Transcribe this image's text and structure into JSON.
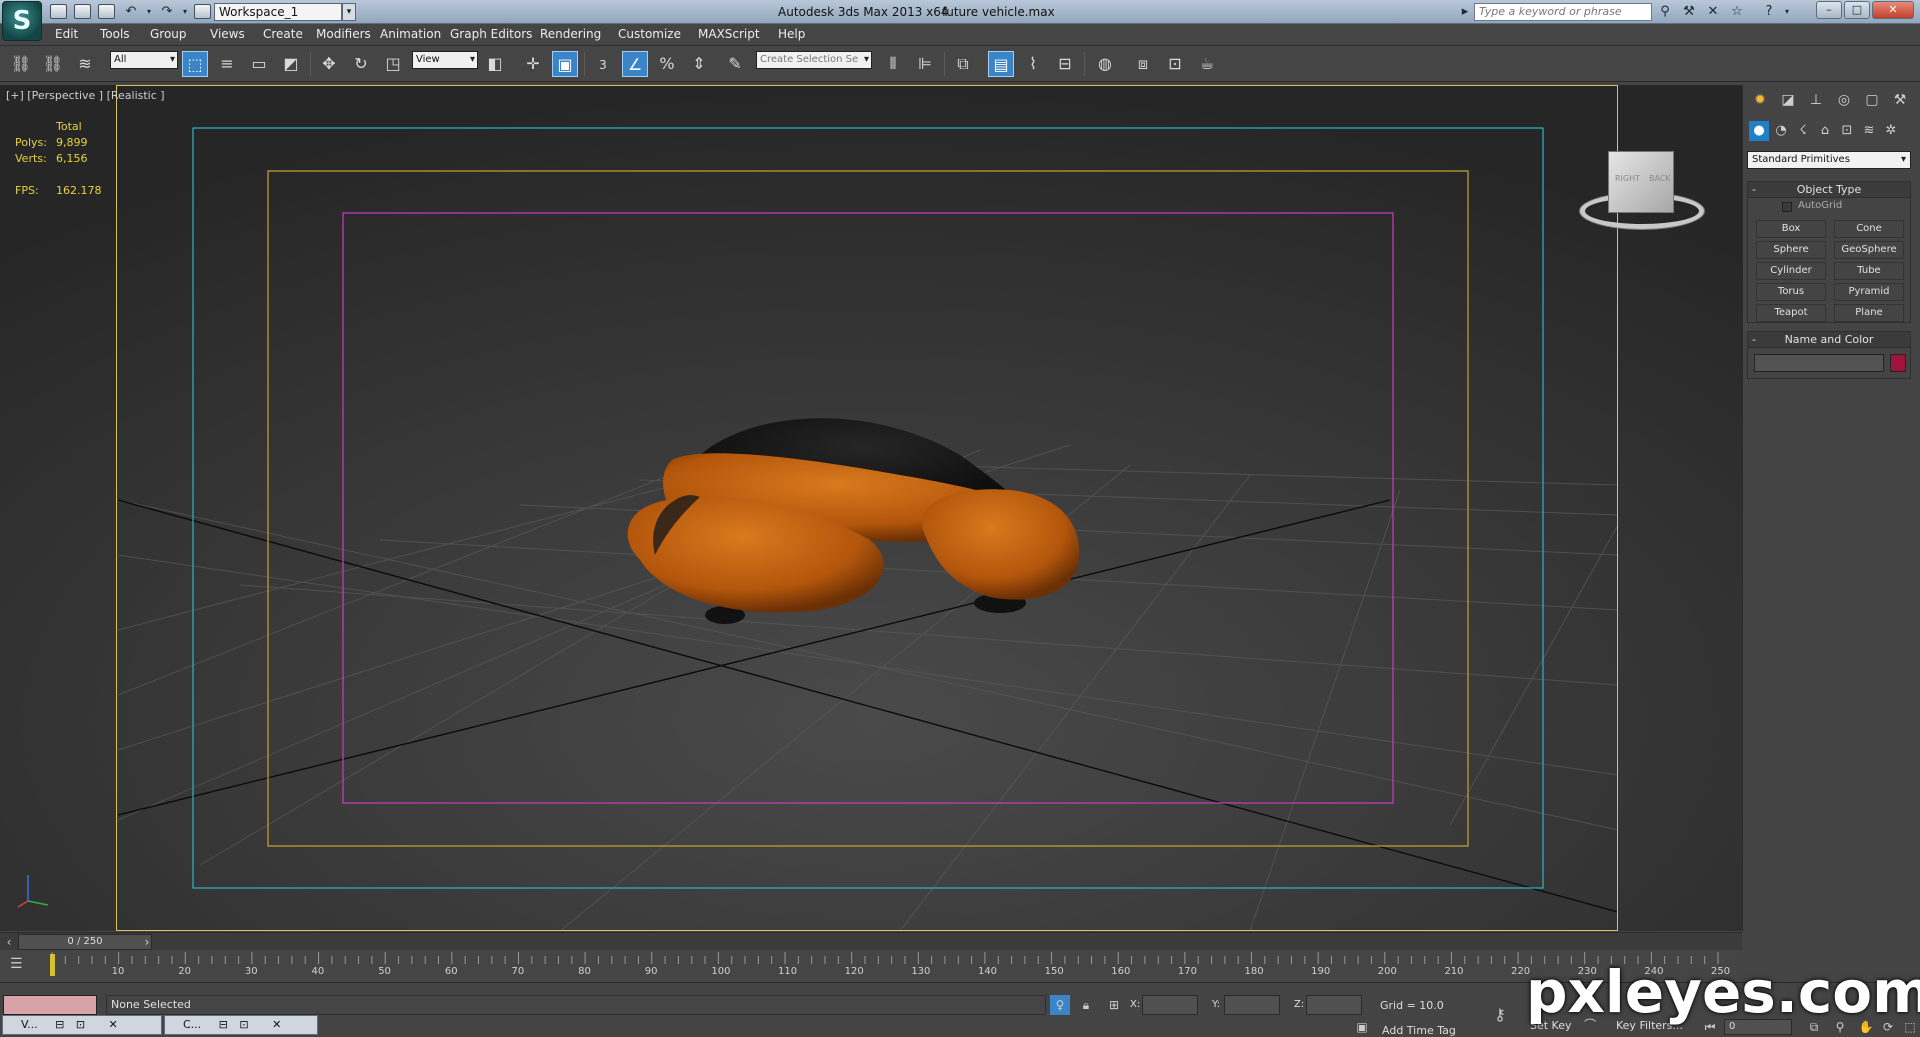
{
  "titlebar": {
    "workspace": "Workspace_1",
    "app_title": "Autodesk 3ds Max  2013 x64",
    "file_name": "future vehicle.max",
    "search_placeholder": "Type a keyword or phrase"
  },
  "menu": [
    "Edit",
    "Tools",
    "Group",
    "Views",
    "Create",
    "Modifiers",
    "Animation",
    "Graph Editors",
    "Rendering",
    "Customize",
    "MAXScript",
    "Help"
  ],
  "toolbar": {
    "selection_filter": "All",
    "ref_coord": "View",
    "snap_label": "3",
    "named_selection": "Create Selection Se"
  },
  "viewport": {
    "label": "[+] [Perspective ] [Realistic ]",
    "stats": {
      "total_label": "Total",
      "polys_label": "Polys:",
      "polys_value": "9,899",
      "verts_label": "Verts:",
      "verts_value": "6,156",
      "fps_label": "FPS:",
      "fps_value": "162.178"
    },
    "viewcube": {
      "right": "RIGHT",
      "back": "BACK"
    },
    "colors": {
      "safe_outer": "#2ab7c4",
      "safe_mid": "#c9a336",
      "safe_inner": "#c93cc4",
      "vehicle": "#c8630f",
      "canopy": "#151515"
    }
  },
  "command_panel": {
    "category": "Standard Primitives",
    "object_type_title": "Object Type",
    "autogrid": "AutoGrid",
    "buttons": [
      "Box",
      "Cone",
      "Sphere",
      "GeoSphere",
      "Cylinder",
      "Tube",
      "Torus",
      "Pyramid",
      "Teapot",
      "Plane"
    ],
    "name_color_title": "Name and Color",
    "swatch_color": "#a0143c"
  },
  "timeline": {
    "frame_display": "0 / 250",
    "ticks": [
      "10",
      "20",
      "30",
      "40",
      "50",
      "60",
      "70",
      "80",
      "90",
      "100",
      "110",
      "120",
      "130",
      "140",
      "150",
      "160",
      "170",
      "180",
      "190",
      "200",
      "210",
      "220",
      "230",
      "240",
      "250"
    ]
  },
  "status": {
    "selection": "None Selected",
    "x_label": "X:",
    "y_label": "Y:",
    "z_label": "Z:",
    "grid": "Grid = 10.0",
    "add_time_tag": "Add Time Tag",
    "set_key": "Set Key",
    "key_filters": "Key Filters...",
    "frame": "0"
  },
  "taskbar": {
    "tab1": "V...",
    "tab2": "C..."
  },
  "watermark": "pxleyes.com"
}
